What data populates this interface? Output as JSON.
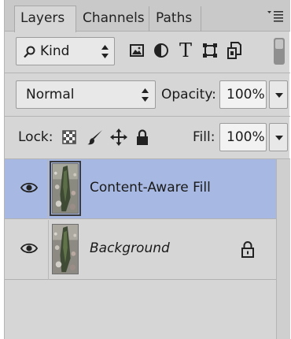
{
  "tabs": [
    {
      "label": "Layers",
      "active": true
    },
    {
      "label": "Channels",
      "active": false
    },
    {
      "label": "Paths",
      "active": false
    }
  ],
  "filter": {
    "kind_label": "Kind",
    "filter_icons": [
      "pixel-layer-filter-icon",
      "adjustment-layer-filter-icon",
      "type-layer-filter-icon",
      "shape-layer-filter-icon",
      "smart-object-filter-icon"
    ],
    "type_filter_glyph": "T"
  },
  "blend": {
    "mode": "Normal",
    "opacity_label": "Opacity:",
    "opacity_value": "100%"
  },
  "lock": {
    "label": "Lock:",
    "icons": [
      "lock-transparent-pixels-icon",
      "lock-image-pixels-icon",
      "lock-position-icon",
      "lock-all-icon"
    ],
    "fill_label": "Fill:",
    "fill_value": "100%"
  },
  "layers": [
    {
      "name": "Content-Aware Fill",
      "visible": true,
      "selected": true,
      "locked": false
    },
    {
      "name": "Background",
      "visible": true,
      "selected": false,
      "locked": true
    }
  ],
  "colors": {
    "panel_bg": "#d6d6d6",
    "selected_row": "#a7b9e2",
    "control_bg": "#e8e8e8"
  }
}
